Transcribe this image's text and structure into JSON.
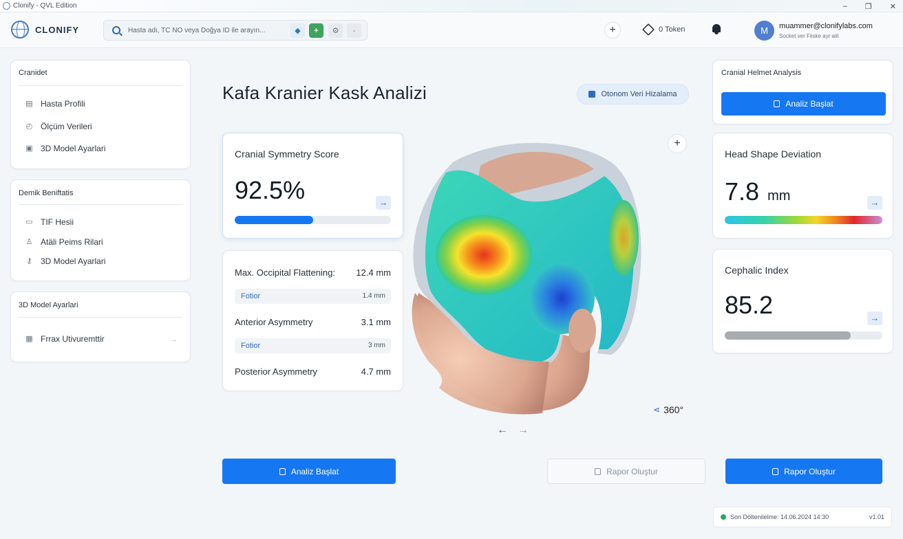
{
  "window": {
    "title": "Clonify - QVL Edition",
    "controls": [
      "–",
      "❐",
      "✕"
    ]
  },
  "header": {
    "brand": "CLONIFY",
    "search_placeholder": "Hasta adı, TC NO veya Doğya ID ile arayın...",
    "search_buttons": [
      "◆",
      "+",
      "⚙",
      "-"
    ],
    "add_label": "+",
    "token_label": "0 Token",
    "avatar_initial": "M",
    "user_email": "muammer@clonifylabs.com",
    "user_sub": "Socket ver Fiiske ayr aiil"
  },
  "sidebar": {
    "sections": [
      {
        "title": "Cranidet",
        "items": [
          {
            "icon": "id-card-icon",
            "glyph": "▤",
            "label": "Hasta Profili"
          },
          {
            "icon": "gauge-icon",
            "glyph": "◴",
            "label": "Ölçüm Verileri"
          },
          {
            "icon": "cube-icon",
            "glyph": "▣",
            "label": "3D Model Ayarlari"
          }
        ]
      },
      {
        "title": "Demik Beniftatis",
        "items": [
          {
            "icon": "document-icon",
            "glyph": "▭",
            "label": "TIF Hesii"
          },
          {
            "icon": "person-icon",
            "glyph": "♙",
            "label": "Atäli Peims Rilari"
          },
          {
            "icon": "key-icon",
            "glyph": "⚷",
            "label": "3D Model Ayarlari"
          }
        ]
      },
      {
        "title": "3D Model Ayarlari",
        "items": [
          {
            "icon": "table-icon",
            "glyph": "▦",
            "label": "Frrax Utivuremttir",
            "trailing": "→"
          }
        ]
      }
    ]
  },
  "main": {
    "title": "Kafa Kranier Kask Analizi",
    "align_pill": "Otonom Veri Hizalama",
    "symmetry": {
      "title": "Cranial Symmetry Score",
      "value": "92.5%",
      "progress": 0.5,
      "bar_color": "#1677f2"
    },
    "measurements": [
      {
        "label": "Max. Occipital Flattening:",
        "value": "12.4 mm"
      },
      {
        "label": "Fotior",
        "value": "1.4 mm",
        "sub": true
      },
      {
        "label": "Anterior Asymmetry",
        "value": "3.1 mm"
      },
      {
        "label": "Fotior",
        "value": "3 mm",
        "sub": true
      },
      {
        "label": "Posterior Asymmetry",
        "value": "4.7 mm"
      }
    ],
    "viewer": {
      "rotate_label": "360°",
      "zoom_label": "+",
      "prev": "←",
      "next": "→"
    },
    "buttons": {
      "analyze": "Analiz Başlat",
      "report_disabled": "Rapor Oluştur"
    }
  },
  "right": {
    "helmet": {
      "title": "Cranial Helmet Analysis",
      "button": "Analiz Başlat"
    },
    "deviation": {
      "title": "Head Shape Deviation",
      "value": "7.8",
      "unit": "mm",
      "progress": 1.0
    },
    "cephalic": {
      "title": "Cephalic Index",
      "value": "85.2",
      "progress": 0.8,
      "bar_color": "#a8acb1"
    },
    "report_button": "Rapor Oluştur"
  },
  "status": {
    "text": "Son Döltenilelme: 14.06.2024 14:30",
    "version": "v1.01",
    "dot_color": "#28a866"
  },
  "colors": {
    "accent": "#1677f2",
    "background": "#f3f6f9"
  }
}
